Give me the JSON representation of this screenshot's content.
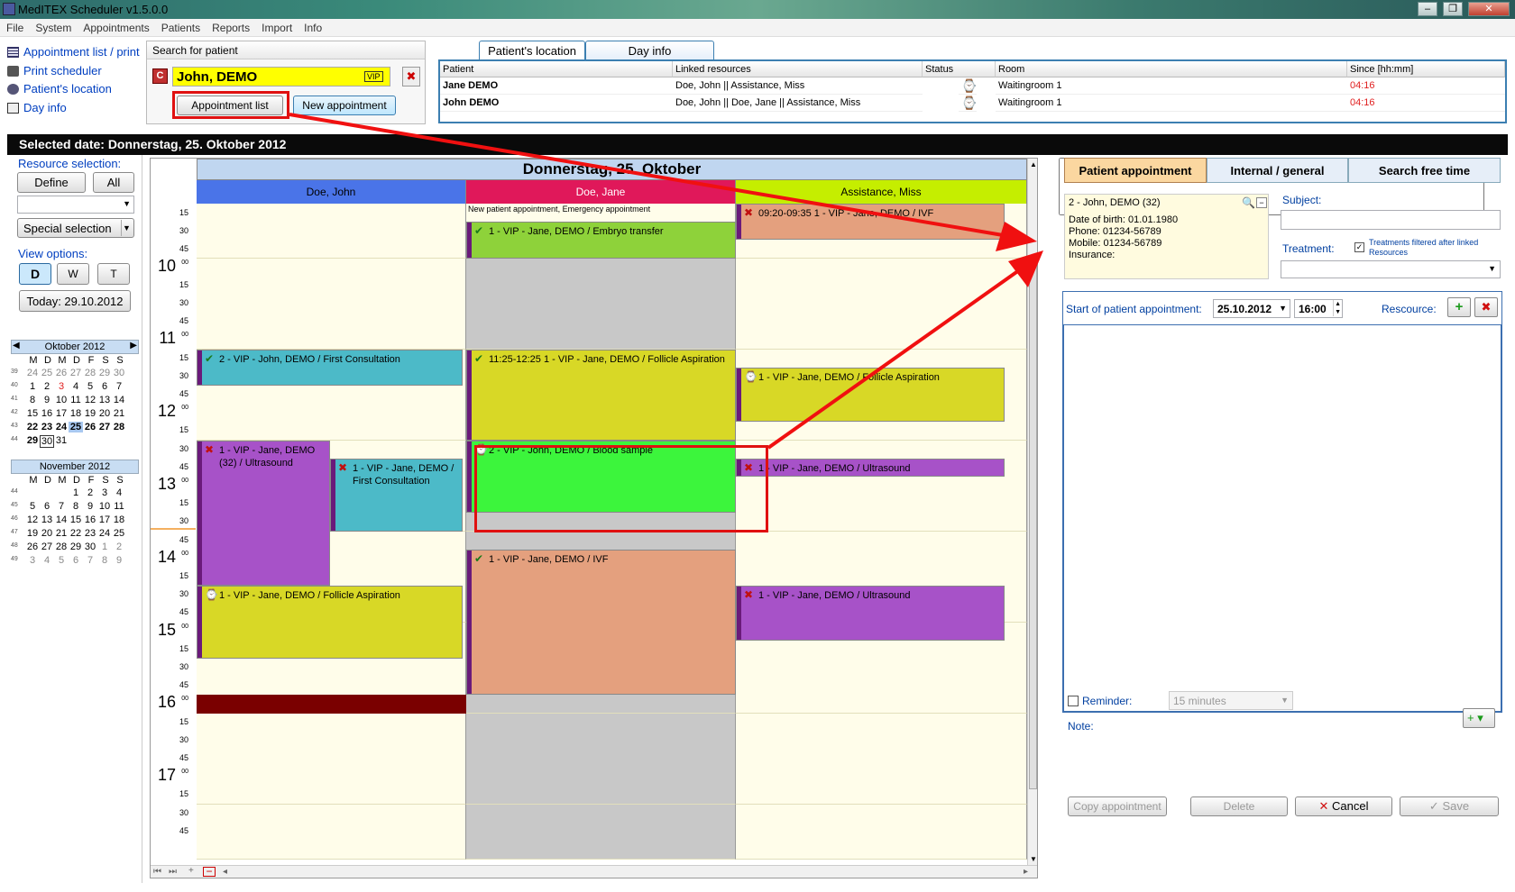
{
  "window": {
    "title": "MedITEX  Scheduler v1.5.0.0"
  },
  "menu": [
    "File",
    "System",
    "Appointments",
    "Patients",
    "Reports",
    "Import",
    "Info"
  ],
  "quick_links": [
    "Appointment list / print",
    "Print scheduler",
    "Patient's location",
    "Day info"
  ],
  "search": {
    "header": "Search for patient",
    "patient_name": "John, DEMO",
    "vip_badge": "VIP",
    "appointment_list_label": "Appointment list",
    "new_appointment_label": "New appointment"
  },
  "location_panel": {
    "tabs": [
      "Patient's location",
      "Day info"
    ],
    "columns": [
      "Patient",
      "Linked resources",
      "Status",
      "Room",
      "Since [hh:mm]"
    ],
    "rows": [
      {
        "patient": "Jane DEMO",
        "resources": "Doe, John || Assistance, Miss",
        "room": "Waitingroom 1",
        "since": "04:16"
      },
      {
        "patient": "John DEMO",
        "resources": "Doe, John || Doe, Jane || Assistance, Miss",
        "room": "Waitingroom 1",
        "since": "04:16"
      }
    ]
  },
  "selected_date": "Selected date: Donnerstag, 25. Oktober 2012",
  "left": {
    "resource_selection_label": "Resource selection:",
    "define_label": "Define",
    "all_label": "All",
    "special_selection_label": "Special selection",
    "view_options_label": "View options:",
    "view_buttons": [
      "D",
      "W",
      "T"
    ],
    "today_label": "Today: 29.10.2012",
    "october": {
      "title": "Oktober 2012",
      "weekdays": [
        "M",
        "D",
        "M",
        "D",
        "F",
        "S",
        "S"
      ],
      "weeks": [
        "39",
        "40",
        "41",
        "42",
        "43",
        "44"
      ],
      "days": [
        [
          "24",
          "25",
          "26",
          "27",
          "28",
          "29",
          "30"
        ],
        [
          "1",
          "2",
          "3",
          "4",
          "5",
          "6",
          "7"
        ],
        [
          "8",
          "9",
          "10",
          "11",
          "12",
          "13",
          "14"
        ],
        [
          "15",
          "16",
          "17",
          "18",
          "19",
          "20",
          "21"
        ],
        [
          "22",
          "23",
          "24",
          "25",
          "26",
          "27",
          "28"
        ],
        [
          "29",
          "30",
          "31",
          "",
          "",
          "",
          ""
        ]
      ]
    },
    "november": {
      "title": "November 2012",
      "weekdays": [
        "M",
        "D",
        "M",
        "D",
        "F",
        "S",
        "S"
      ],
      "weeks": [
        "44",
        "45",
        "46",
        "47",
        "48",
        "49"
      ],
      "days": [
        [
          "",
          "",
          "",
          "1",
          "2",
          "3",
          "4"
        ],
        [
          "5",
          "6",
          "7",
          "8",
          "9",
          "10",
          "11"
        ],
        [
          "12",
          "13",
          "14",
          "15",
          "16",
          "17",
          "18"
        ],
        [
          "19",
          "20",
          "21",
          "22",
          "23",
          "24",
          "25"
        ],
        [
          "26",
          "27",
          "28",
          "29",
          "30",
          "1",
          "2"
        ],
        [
          "3",
          "4",
          "5",
          "6",
          "7",
          "8",
          "9"
        ]
      ]
    }
  },
  "scheduler": {
    "day_title": "Donnerstag, 25. Oktober",
    "resources": [
      {
        "name": "Doe, John",
        "color": "#4a74e8"
      },
      {
        "name": "Doe, Jane",
        "color": "#e0185a"
      },
      {
        "name": "Assistance, Miss",
        "color": "#c5ee00"
      }
    ],
    "top_note": "New patient appointment, Emergency appointment",
    "hours": [
      "10",
      "11",
      "12",
      "13",
      "14",
      "15",
      "16",
      "17"
    ],
    "minutes": [
      "00",
      "15",
      "30",
      "45"
    ],
    "first_slot_minutes": [
      "15",
      "30",
      "45"
    ],
    "appointments": [
      {
        "text": "1 - VIP - Jane, DEMO / Embryo transfer",
        "color": "#8ed23a"
      },
      {
        "text": "09:20-09:35 1 - VIP - Jane, DEMO / IVF",
        "color": "#e4a07e"
      },
      {
        "text": "2 - VIP - John, DEMO / First Consultation",
        "color": "#4cbac8"
      },
      {
        "text": "11:25-12:25 1 - VIP - Jane, DEMO / Follicle Aspiration",
        "color": "#d8d826"
      },
      {
        "text": "1 - VIP - Jane, DEMO / Follicle Aspiration",
        "color": "#d8d826"
      },
      {
        "text": "1 - VIP - Jane, DEMO (32) / Ultrasound",
        "color": "#a752c8"
      },
      {
        "text": "1 - VIP - Jane, DEMO / First Consultation",
        "color": "#4cbac8"
      },
      {
        "text": "2 - VIP - John, DEMO / Blood sample",
        "color": "#3cf53c"
      },
      {
        "text": "1 - VIP - Jane, DEMO / Ultrasound",
        "color": "#a752c8"
      },
      {
        "text": "1 - VIP - Jane, DEMO / IVF",
        "color": "#e4a07e"
      },
      {
        "text": "1 - VIP - Jane, DEMO / Follicle Aspiration",
        "color": "#d8d826"
      },
      {
        "text": "1 - VIP - Jane, DEMO / Ultrasound",
        "color": "#a752c8"
      }
    ]
  },
  "right": {
    "tabs": [
      "Patient appointment",
      "Internal / general",
      "Search free time"
    ],
    "patient_header": "2 - John, DEMO (32)",
    "patient_details": [
      "Date of birth: 01.01.1980",
      "Phone: 01234-56789",
      "Mobile: 01234-56789",
      "Insurance:"
    ],
    "subject_label": "Subject:",
    "treatment_label": "Treatment:",
    "treatments_filtered_label": "Treatments filtered after linked Resources",
    "start_label": "Start of patient appointment:",
    "start_date": "25.10.2012",
    "start_time": "16:00",
    "resource_label": "Rescource:",
    "reminder_label": "Reminder:",
    "reminder_value": "15 minutes",
    "note_label": "Note:",
    "copy_label": "Copy appointment",
    "delete_label": "Delete",
    "cancel_label": "Cancel",
    "save_label": "Save"
  }
}
